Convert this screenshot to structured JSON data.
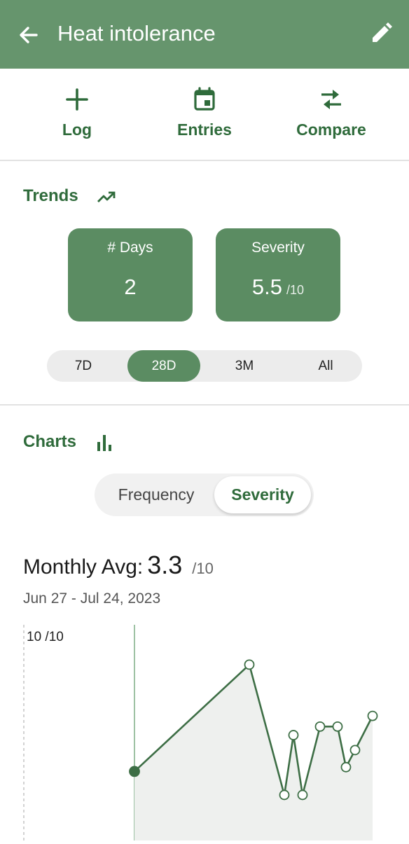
{
  "header": {
    "title": "Heat intolerance",
    "back_icon": "arrow-left-icon",
    "edit_icon": "pencil-icon"
  },
  "actions": [
    {
      "label": "Log",
      "icon": "plus-icon"
    },
    {
      "label": "Entries",
      "icon": "calendar-icon"
    },
    {
      "label": "Compare",
      "icon": "swap-arrows-icon"
    }
  ],
  "trends": {
    "title": "Trends",
    "icon": "trending-up-icon",
    "cards": [
      {
        "label": "# Days",
        "value": "2",
        "suffix": ""
      },
      {
        "label": "Severity",
        "value": "5.5",
        "suffix": "/10"
      }
    ],
    "ranges": [
      "7D",
      "28D",
      "3M",
      "All"
    ],
    "selected_range": "28D"
  },
  "charts": {
    "title": "Charts",
    "icon": "bar-chart-icon",
    "toggle": {
      "options": [
        "Frequency",
        "Severity"
      ],
      "selected": "Severity"
    },
    "avg_label": "Monthly Avg:",
    "avg_value": "3.3",
    "avg_suffix": "/10",
    "date_range": "Jun 27 - Jul 24, 2023"
  },
  "chart_data": {
    "type": "line",
    "y_max_label": "10 /10",
    "ylim": [
      0,
      10
    ],
    "series": [
      {
        "values": [
          3.2,
          8.2,
          2.1,
          4.9,
          2.1,
          5.3,
          5.3,
          3.4,
          4.2,
          5.8
        ]
      }
    ],
    "first_point_filled": true
  },
  "colors": {
    "brand": "#66956d",
    "accent": "#2f6b3b",
    "card": "#5b8c62",
    "line": "#3d6e45"
  }
}
